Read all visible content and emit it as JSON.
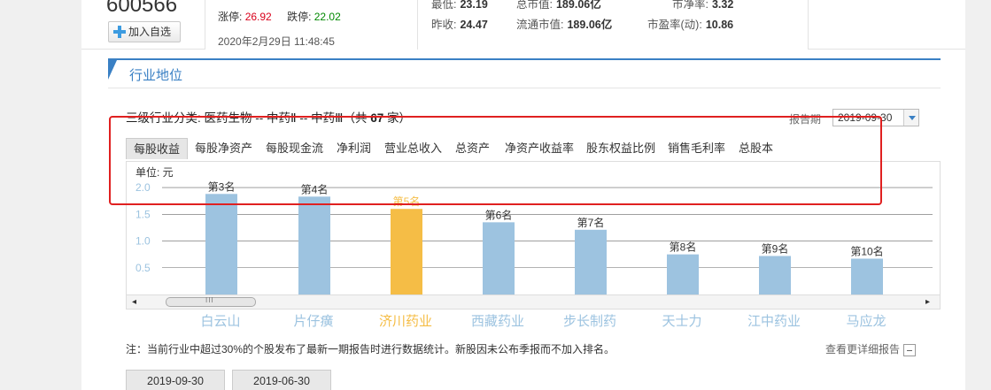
{
  "stock": {
    "code": "600566",
    "add_watchlist_label": "加入自选"
  },
  "limits": {
    "up_label": "涨停:",
    "up_value": "26.92",
    "down_label": "跌停:",
    "down_value": "22.02",
    "datetime": "2020年2月29日 11:48:45"
  },
  "quote": {
    "low_label": "最低:",
    "low_value": "23.19",
    "mktcap_label": "总市值:",
    "mktcap_value": "189.06亿",
    "pb_label": "市净率:",
    "pb_value": "3.32",
    "prev_close_label": "昨收:",
    "prev_close_value": "24.47",
    "float_cap_label": "流通市值:",
    "float_cap_value": "189.06亿",
    "pe_label": "市盈率(动):",
    "pe_value": "10.86"
  },
  "section": {
    "title": "行业地位",
    "industry_prefix": "三级行业分类:",
    "industry_path": "医药生物 -- 中药Ⅱ -- 中药Ⅲ（共",
    "industry_count": "67",
    "industry_suffix": "家）",
    "report_label": "报告期",
    "report_value": "2019-09-30"
  },
  "tabs": [
    "每股收益",
    "每股净资产",
    "每股现金流",
    "净利润",
    "营业总收入",
    "总资产",
    "净资产收益率",
    "股东权益比例",
    "销售毛利率",
    "总股本"
  ],
  "active_tab": 0,
  "unit_label": "单位: 元",
  "chart_data": {
    "type": "bar",
    "categories": [
      "白云山",
      "片仔癀",
      "济川药业",
      "西藏药业",
      "步长制药",
      "天士力",
      "江中药业",
      "马应龙"
    ],
    "rank_labels": [
      "第3名",
      "第4名",
      "第5名",
      "第6名",
      "第7名",
      "第8名",
      "第9名",
      "第10名"
    ],
    "values": [
      1.88,
      1.83,
      1.6,
      1.35,
      1.21,
      0.75,
      0.72,
      0.67
    ],
    "highlight_index": 2,
    "y_ticks": [
      "0.5",
      "1.0",
      "1.5",
      "2.0"
    ],
    "ylim": [
      0,
      2.0
    ],
    "colors": {
      "bar": "#9dc3e0",
      "highlight": "#f5bd46"
    }
  },
  "note": "注：当前行业中超过30%的个股发布了最新一期报告时进行数据统计。新股因未公布季报而不加入排名。",
  "more_link": "查看更详细报告",
  "periods": [
    "2019-09-30",
    "2019-06-30"
  ]
}
